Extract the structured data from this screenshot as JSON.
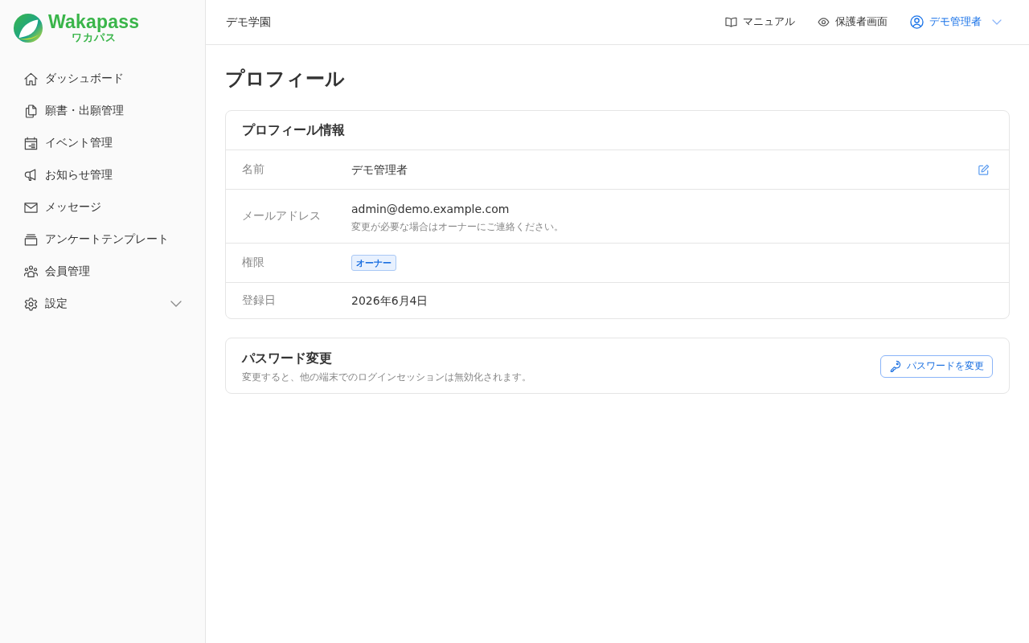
{
  "sidebar": {
    "logo": {
      "name": "Wakapass",
      "kana": "ワカパス"
    },
    "items": [
      {
        "kind": "link",
        "label": "ダッシュボード"
      },
      {
        "kind": "link",
        "label": "願書・出願管理"
      },
      {
        "kind": "link",
        "label": "イベント管理"
      },
      {
        "kind": "link",
        "label": "お知らせ管理"
      },
      {
        "kind": "link",
        "label": "メッセージ"
      },
      {
        "kind": "link",
        "label": "アンケートテンプレート"
      },
      {
        "kind": "link",
        "label": "会員管理"
      },
      {
        "kind": "group",
        "label": "設定",
        "expanded": false
      }
    ]
  },
  "header": {
    "school_name": "デモ学園",
    "links": [
      {
        "label": "マニュアル"
      },
      {
        "label": "保護者画面"
      }
    ],
    "user_menu": {
      "label": "デモ管理者"
    }
  },
  "page_title": "プロフィール",
  "profile_card": {
    "title": "プロフィール情報",
    "rows": [
      {
        "kind": "text",
        "label": "名前",
        "value": "デモ管理者",
        "editable": true
      },
      {
        "kind": "text",
        "label": "メールアドレス",
        "value": "admin@demo.example.com",
        "note": "変更が必要な場合はオーナーにご連絡ください。",
        "editable": false
      },
      {
        "kind": "badge",
        "label": "権限",
        "value": "オーナー",
        "editable": false
      },
      {
        "kind": "text",
        "label": "登録日",
        "value": "2026年6月4日",
        "editable": false
      }
    ]
  },
  "password_card": {
    "title": "パスワード変更",
    "description": "変更すると、他の端末でのログインセッションは無効化されます。",
    "button": "パスワードを変更"
  }
}
